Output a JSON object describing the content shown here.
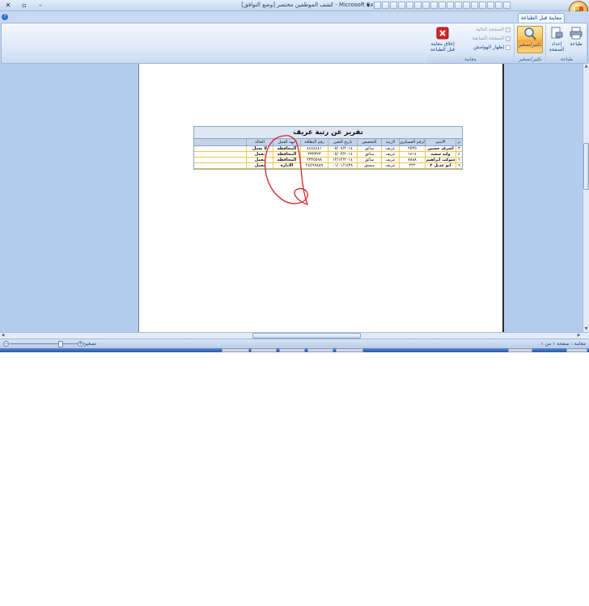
{
  "window": {
    "title": "كشف الموظفين مختصر  [وضع التوافق] - Microsoft Excel",
    "minimize": "–",
    "restore": "▫",
    "close": "✕",
    "qat_toggle": "▾"
  },
  "ribbon": {
    "tab_label": "معاينة قبل الطباعة",
    "help": "?",
    "groups": {
      "print": {
        "label": "طباعة",
        "print_btn": "طباعة",
        "setup_btn": "إعداد الصفحة"
      },
      "zoom": {
        "label": "تكبير/تصغير",
        "zoom_btn": "تكبير/تصغير"
      },
      "preview": {
        "label": "معاينة",
        "next_page": "الصفحة التالية",
        "prev_page": "الصفحة السابقة",
        "show_margins": "إظهار الهوامش",
        "close_btn": "إغلاق معاينة قبل الطباعة"
      }
    }
  },
  "report": {
    "title": "تقرير عن رتبة  عريف",
    "columns": [
      "م",
      "الاسم",
      "الرقم العسكري",
      "الرتبة",
      "التخصص",
      "تاريخ التعين",
      "رقم البطاقة",
      "جهة العمل",
      "الحالة"
    ],
    "rows": [
      [
        "٣",
        "اشرف حسين",
        "٢٥٢٥",
        "عريف",
        "سائق",
        "٠٥/٠٩/٢٠١٤",
        "٤٤٤٤٤٤١",
        "المحافظة",
        "لا يعمل"
      ],
      [
        "٤",
        "وليد سعيد",
        "١٤١٤",
        "عريف",
        "سائق",
        "٠٥/٠٣/٢٠١٤",
        "٢٣٣٣٢٣",
        "المحافظة",
        "يعمل"
      ],
      [
        "٦",
        "شوكت ابراهيم",
        "٨٨٨٨",
        "عريف",
        "سائق",
        "١٢/١٢/٢٠١٤",
        "٢٣٢٥٥٩٨",
        "المحافظة",
        "يعمل"
      ],
      [
        "٩",
        "ابو عديل ٢",
        "٢٢٢",
        "عريف",
        "منسق",
        "٠١/٠١/١٤٣٨",
        "٢٤٥٦٧٨٨٩",
        "الادارة",
        "يعمل"
      ]
    ]
  },
  "statusbar": {
    "status": "معاينة : صفحة ١ من ١",
    "zoom_label": "تصغير",
    "zoom_minus": "−",
    "zoom_plus": "+"
  },
  "colors": {
    "accent": "#15428b",
    "annotation": "#d8232a",
    "row_border": "#f0c64a"
  }
}
